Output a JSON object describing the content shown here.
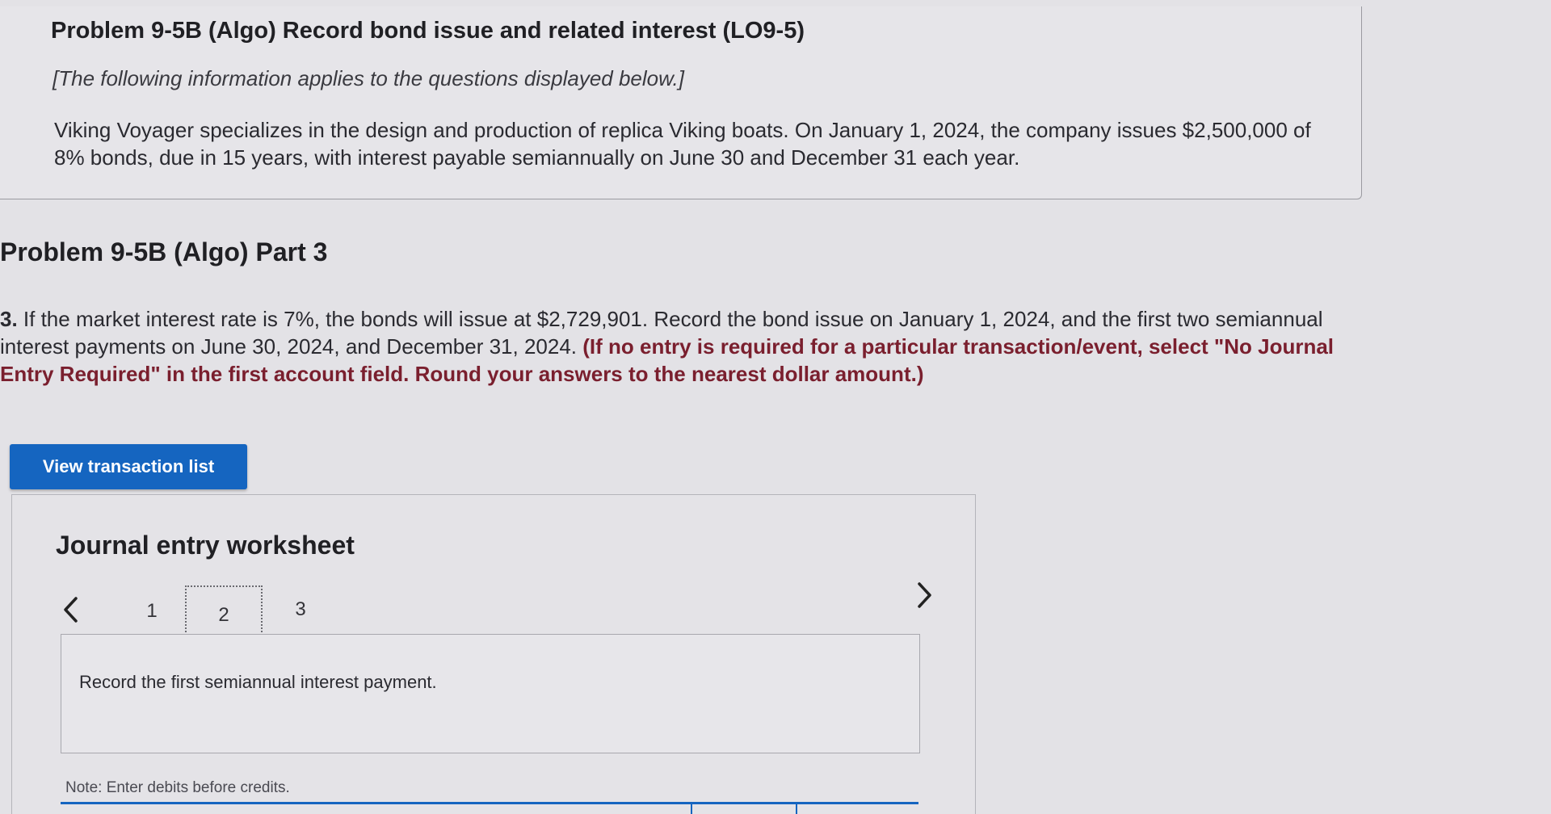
{
  "header": {
    "title": "Problem 9-5B (Algo) Record bond issue and related interest (LO9-5)",
    "note": "[The following information applies to the questions displayed below.]",
    "paragraph": "Viking Voyager specializes in the design and production of replica Viking boats. On January 1, 2024, the company issues $2,500,000 of 8% bonds, due in 15 years, with interest payable semiannually on June 30 and December 31 each year."
  },
  "part": {
    "title": "Problem 9-5B (Algo) Part 3"
  },
  "question": {
    "number": "3.",
    "text": " If the market interest rate is 7%, the bonds will issue at $2,729,901. Record the bond issue on January 1, 2024, and the first two semiannual interest payments on June 30, 2024, and December 31, 2024. ",
    "instruction": "(If no entry is required for a particular transaction/event, select \"No Journal Entry Required\" in the first account field. Round your answers to the nearest dollar amount.)"
  },
  "buttons": {
    "view_transactions": "View transaction list"
  },
  "worksheet": {
    "title": "Journal entry worksheet",
    "pages": [
      "1",
      "2",
      "3"
    ],
    "active_page": "2",
    "entry_description": "Record the first semiannual interest payment.",
    "note": "Note: Enter debits before credits."
  },
  "colors": {
    "accent": "#1565c0",
    "instruction": "#7a1f2e",
    "background": "#e3e2e6"
  }
}
